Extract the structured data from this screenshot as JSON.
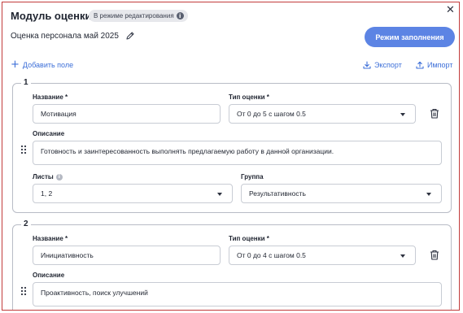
{
  "header": {
    "title": "Модуль оценки",
    "mode_badge": "В режиме редактирования",
    "info_glyph": "i",
    "close_glyph": "✕"
  },
  "document": {
    "name": "Оценка персонала май 2025"
  },
  "toolbar": {
    "fill_mode_label": "Режим заполнения",
    "add_field_label": "Добавить поле",
    "add_glyph": "+",
    "export_label": "Экспорт",
    "import_label": "Импорт"
  },
  "colors": {
    "accent": "#5c84e4",
    "link": "#3d6fd8",
    "frame_border": "#c23b3b",
    "card_border": "#b8bcc6"
  },
  "cards": [
    {
      "number": "1",
      "name_label": "Название *",
      "name_value": "Мотивация",
      "type_label": "Тип оценки *",
      "type_value": "От 0 до 5 с шагом 0.5",
      "description_label": "Описание",
      "description_value": "Готовность и заинтересованность выполнять предлагаемую работу в данной организации.",
      "sheets_label": "Листы",
      "sheets_value": "1, 2",
      "group_label": "Группа",
      "group_value": "Результативность"
    },
    {
      "number": "2",
      "name_label": "Название *",
      "name_value": "Инициативность",
      "type_label": "Тип оценки *",
      "type_value": "От 0 до 4 с шагом 0.5",
      "description_label": "Описание",
      "description_value": "Проактивность, поиск улучшений"
    }
  ]
}
